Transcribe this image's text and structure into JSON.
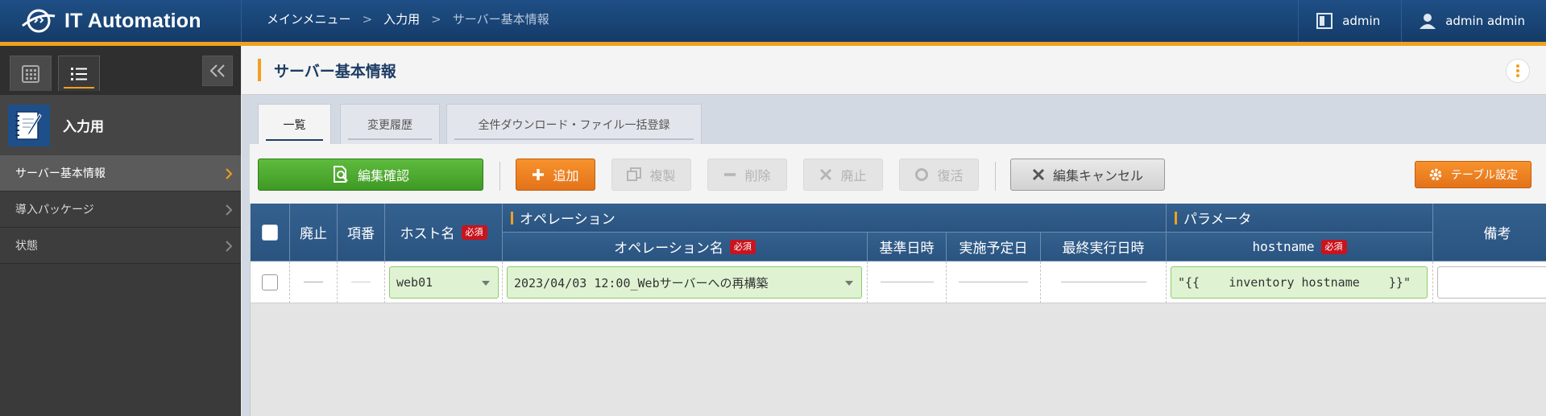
{
  "app": {
    "name": "IT Automation"
  },
  "breadcrumb": {
    "items": [
      "メインメニュー",
      "入力用",
      "サーバー基本情報"
    ]
  },
  "header": {
    "workspace_label": "admin",
    "user_label": "admin admin"
  },
  "sidebar": {
    "menu_group_title": "入力用",
    "items": [
      {
        "label": "サーバー基本情報",
        "active": true
      },
      {
        "label": "導入パッケージ",
        "active": false
      },
      {
        "label": "状態",
        "active": false
      }
    ]
  },
  "page": {
    "title": "サーバー基本情報"
  },
  "tabs": [
    {
      "label": "一覧",
      "active": true
    },
    {
      "label": "変更履歴",
      "active": false
    },
    {
      "label": "全件ダウンロード・ファイル一括登録",
      "active": false
    }
  ],
  "toolbar": {
    "edit_confirm": "編集確認",
    "add": "追加",
    "duplicate": "複製",
    "delete": "削除",
    "discard": "廃止",
    "restore": "復活",
    "edit_cancel": "編集キャンセル",
    "table_settings": "テーブル設定"
  },
  "table": {
    "headers": {
      "discard": "廃止",
      "item_no": "項番",
      "host_name": "ホスト名",
      "operation_group": "オペレーション",
      "operation_name": "オペレーション名",
      "base_datetime": "基準日時",
      "scheduled_date": "実施予定日",
      "last_run_datetime": "最終実行日時",
      "parameter_group": "パラメータ",
      "hostname_param": "hostname",
      "remarks": "備考",
      "required_badge": "必須"
    },
    "rows": [
      {
        "host_name": "web01",
        "operation_name": "2023/04/03 12:00_Webサーバーへの再構築",
        "hostname_value": "\"{{    inventory hostname    }}\"",
        "remarks": ""
      }
    ]
  },
  "colors": {
    "header_bg": "#1a4679",
    "accent": "#f0a020",
    "primary_green": "#4caa2e",
    "add_orange": "#f08222",
    "required_red": "#c8141e",
    "table_header": "#2f5a87"
  }
}
